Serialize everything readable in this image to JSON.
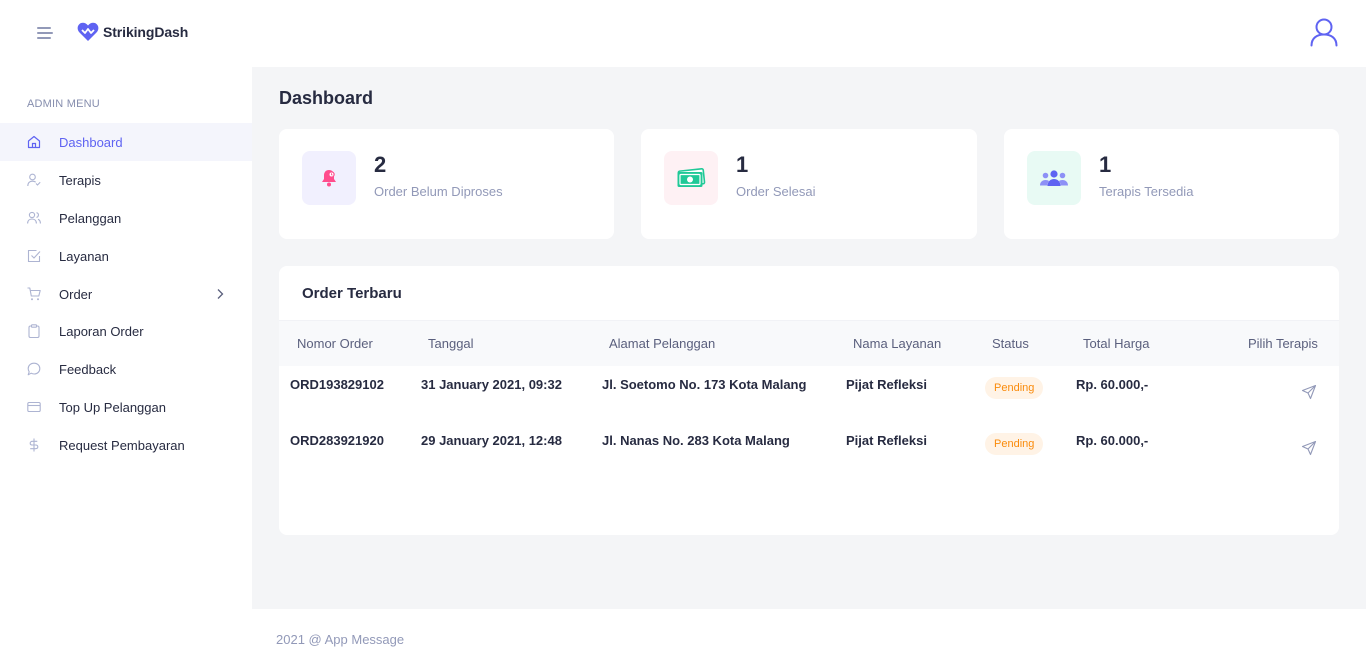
{
  "header": {
    "brand": "StrikingDash",
    "menu_toggle_icon": "hamburger-icon",
    "user_icon": "user-icon",
    "brand_color": "#5f63f2"
  },
  "sidebar": {
    "heading": "ADMIN MENU",
    "items": [
      {
        "label": "Dashboard",
        "icon": "home-icon",
        "active": true
      },
      {
        "label": "Terapis",
        "icon": "user-check-icon"
      },
      {
        "label": "Pelanggan",
        "icon": "users-icon"
      },
      {
        "label": "Layanan",
        "icon": "check-square-icon"
      },
      {
        "label": "Order",
        "icon": "shopping-cart-icon",
        "has_submenu": true
      },
      {
        "label": "Laporan Order",
        "icon": "clipboard-icon"
      },
      {
        "label": "Feedback",
        "icon": "message-circle-icon"
      },
      {
        "label": "Top Up Pelanggan",
        "icon": "credit-card-icon"
      },
      {
        "label": "Request Pembayaran",
        "icon": "dollar-sign-icon"
      }
    ]
  },
  "main": {
    "title": "Dashboard",
    "stats": [
      {
        "value": "2",
        "label": "Order Belum Diproses",
        "icon": "bell-icon",
        "color": "#ff4d8d"
      },
      {
        "value": "1",
        "label": "Order Selesai",
        "icon": "money-icon",
        "color": "#20c997"
      },
      {
        "value": "1",
        "label": "Terapis Tersedia",
        "icon": "team-icon",
        "color": "#5f63f2"
      }
    ],
    "orders": {
      "title": "Order Terbaru",
      "columns": [
        "Nomor Order",
        "Tanggal",
        "Alamat Pelanggan",
        "Nama Layanan",
        "Status",
        "Total Harga",
        "Pilih Terapis"
      ],
      "rows": [
        {
          "nomor": "ORD193829102",
          "tanggal": "31 January 2021, 09:32",
          "alamat": "Jl. Soetomo No. 173 Kota Malang",
          "layanan": "Pijat Refleksi",
          "status": "Pending",
          "total": "Rp. 60.000,-",
          "action_icon": "send-icon"
        },
        {
          "nomor": "ORD283921920",
          "tanggal": "29 January 2021, 12:48",
          "alamat": "Jl. Nanas No. 283 Kota Malang",
          "layanan": "Pijat Refleksi",
          "status": "Pending",
          "total": "Rp. 60.000,-",
          "action_icon": "send-icon"
        }
      ]
    }
  },
  "footer": {
    "text": "2021 @ App Message"
  }
}
